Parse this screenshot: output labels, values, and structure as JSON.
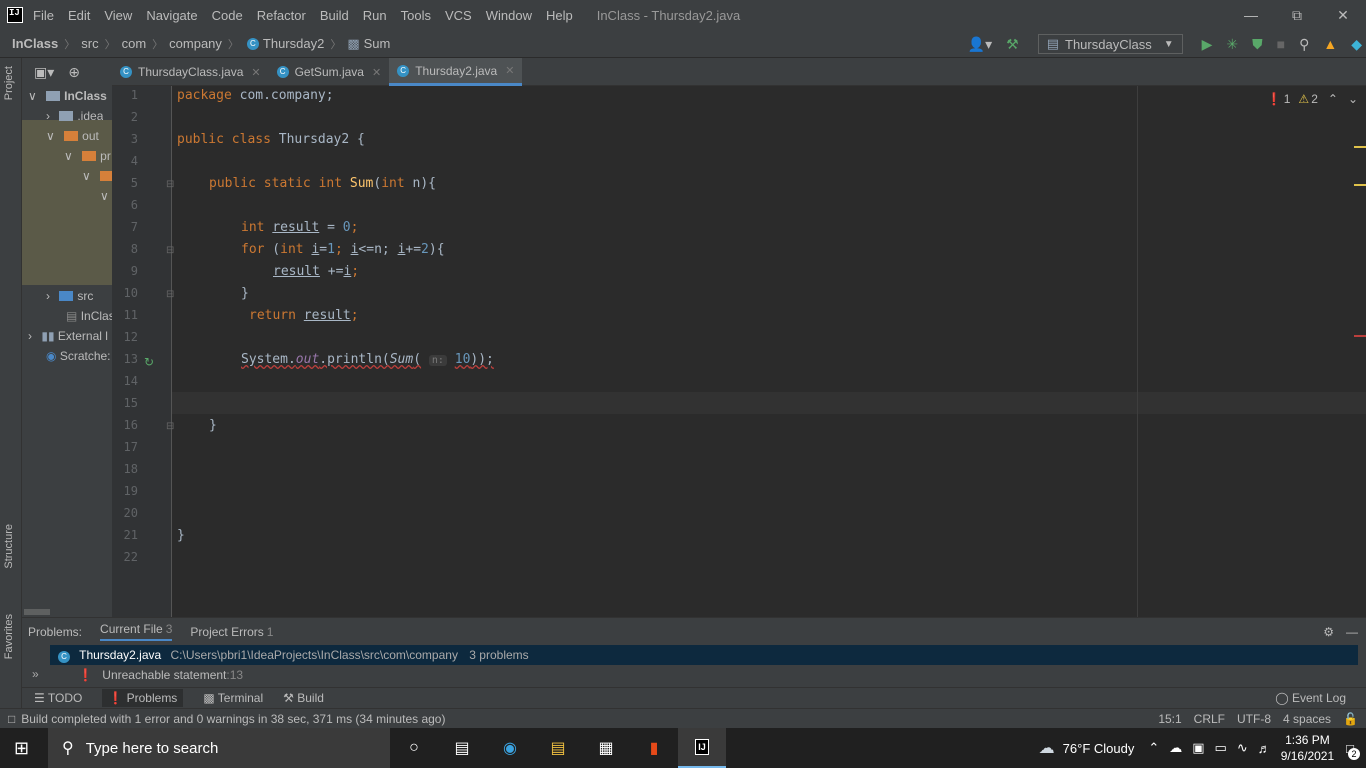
{
  "menu": [
    "File",
    "Edit",
    "View",
    "Navigate",
    "Code",
    "Refactor",
    "Build",
    "Run",
    "Tools",
    "VCS",
    "Window",
    "Help"
  ],
  "window_title": "InClass - Thursday2.java",
  "breadcrumb": {
    "project": "InClass",
    "src": "src",
    "com": "com",
    "company": "company",
    "class": "Thursday2",
    "method": "Sum"
  },
  "run_config": "ThursdayClass",
  "sidebar": {
    "project": "Project",
    "structure": "Structure",
    "favorites": "Favorites"
  },
  "tree": {
    "root": "InClass",
    "idea": ".idea",
    "out": "out",
    "pr": "pr",
    "src": "src",
    "iml": "InClas",
    "ext": "External l",
    "scratches": "Scratche:"
  },
  "tabs": [
    {
      "label": "ThursdayClass.java"
    },
    {
      "label": "GetSum.java"
    },
    {
      "label": "Thursday2.java"
    }
  ],
  "inspector": {
    "errors": "1",
    "warnings": "2"
  },
  "lines": [
    "1",
    "2",
    "3",
    "4",
    "5",
    "6",
    "7",
    "8",
    "9",
    "10",
    "11",
    "12",
    "13",
    "14",
    "15",
    "16",
    "17",
    "18",
    "19",
    "20",
    "21",
    "22"
  ],
  "code": {
    "l1_kw": "package",
    "l1_rest": " com.company;",
    "l3_kw1": "public",
    "l3_kw2": "class",
    "l3_name": "Thursday2",
    "l3_rest": " {",
    "l5_kw1": "public",
    "l5_kw2": "static",
    "l5_kw3": "int",
    "l5_fn": "Sum",
    "l5_p1": "(",
    "l5_kw4": "int",
    "l5_p2": " n){",
    "l7_kw": "int",
    "l7_var": "result",
    "l7_eq": " = ",
    "l7_num": "0",
    "l7_end": ";",
    "l8_kw": "for",
    "l8_a": " (",
    "l8_kw2": "int",
    "l8_i1": "i",
    "l8_eq": "=",
    "l8_n1": "1",
    "l8_b": "; ",
    "l8_i2": "i",
    "l8_c": "<=n; ",
    "l8_i3": "i",
    "l8_d": "+=",
    "l8_n2": "2",
    "l8_e": "){",
    "l9_var": "result",
    "l9_a": " +=",
    "l9_i": "i",
    "l9_end": ";",
    "l10": "}",
    "l11_kw": "return",
    "l11_var": "result",
    "l11_end": ";",
    "l13_a": "System.",
    "l13_out": "out",
    "l13_b": ".println(",
    "l13_sum": "Sum",
    "l13_c": "(",
    "l13_hint": "n:",
    "l13_num": "10",
    "l13_d": "));",
    "l16": "}",
    "l21": "}"
  },
  "problems": {
    "label": "Problems:",
    "current": "Current File",
    "current_count": "3",
    "project": "Project Errors",
    "project_count": "1",
    "file": "Thursday2.java",
    "path": "C:\\Users\\pbri1\\IdeaProjects\\InClass\\src\\com\\company",
    "count": "3 problems",
    "item": "Unreachable statement",
    "item_line": ":13"
  },
  "toolwindows": {
    "todo": "TODO",
    "problems": "Problems",
    "terminal": "Terminal",
    "build": "Build",
    "eventlog": "Event Log"
  },
  "status": {
    "message": "Build completed with 1 error and 0 warnings in 38 sec, 371 ms (34 minutes ago)",
    "pos": "15:1",
    "eol": "CRLF",
    "enc": "UTF-8",
    "indent": "4 spaces"
  },
  "taskbar": {
    "search": "Type here to search",
    "weather": "76°F  Cloudy",
    "time": "1:36 PM",
    "date": "9/16/2021",
    "notif": "2"
  }
}
